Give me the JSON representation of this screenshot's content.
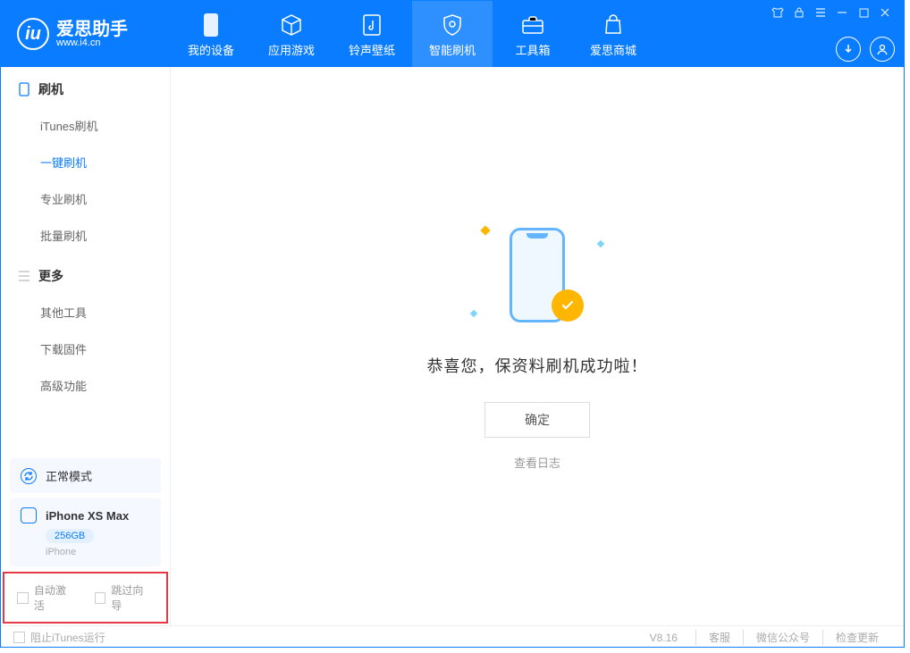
{
  "app": {
    "name": "爱思助手",
    "url": "www.i4.cn"
  },
  "nav": {
    "my_device": "我的设备",
    "apps_games": "应用游戏",
    "ring_wall": "铃声壁纸",
    "smart_flash": "智能刷机",
    "toolbox": "工具箱",
    "store": "爱思商城"
  },
  "sidebar": {
    "flash_hdr": "刷机",
    "itunes_flash": "iTunes刷机",
    "one_key": "一键刷机",
    "pro_flash": "专业刷机",
    "batch_flash": "批量刷机",
    "more_hdr": "更多",
    "other_tools": "其他工具",
    "download_fw": "下载固件",
    "advanced": "高级功能"
  },
  "mode": {
    "label": "正常模式"
  },
  "device": {
    "name": "iPhone XS Max",
    "capacity": "256GB",
    "type": "iPhone"
  },
  "opts": {
    "auto_activate": "自动激活",
    "skip_guide": "跳过向导"
  },
  "main": {
    "success": "恭喜您，保资料刷机成功啦！",
    "ok": "确定",
    "view_log": "查看日志"
  },
  "footer": {
    "block_itunes": "阻止iTunes运行",
    "version": "V8.16",
    "service": "客服",
    "wechat": "微信公众号",
    "update": "检查更新"
  }
}
